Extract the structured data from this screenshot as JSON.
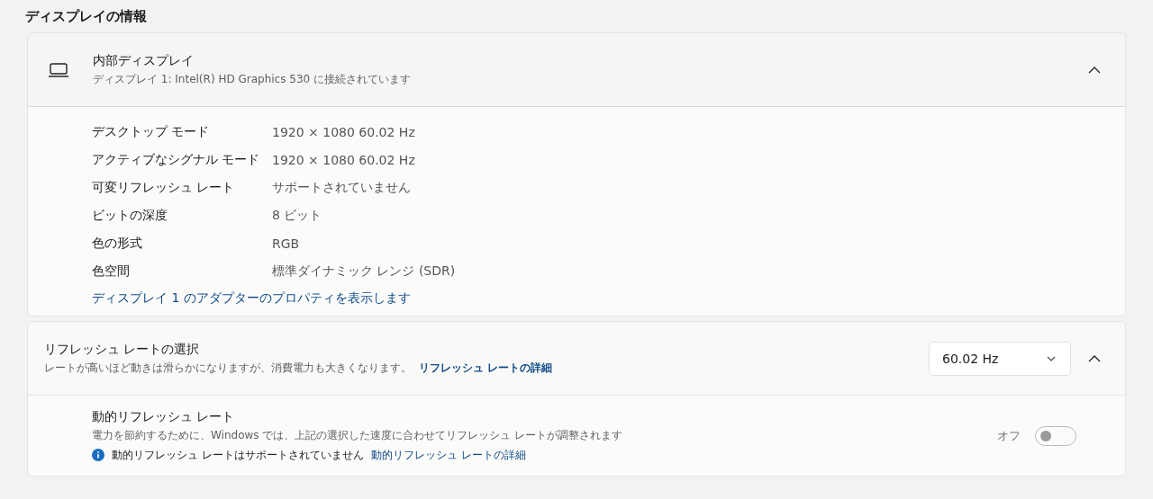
{
  "section_title": "ディスプレイの情報",
  "display_card": {
    "title": "内部ディスプレイ",
    "subtitle": "ディスプレイ 1: Intel(R) HD Graphics 530 に接続されています",
    "expanded": true,
    "properties": [
      {
        "label": "デスクトップ モード",
        "value": "1920 × 1080 60.02 Hz"
      },
      {
        "label": "アクティブなシグナル モード",
        "value": "1920 × 1080 60.02 Hz"
      },
      {
        "label": "可変リフレッシュ レート",
        "value": "サポートされていません"
      },
      {
        "label": "ビットの深度",
        "value": "8 ビット"
      },
      {
        "label": "色の形式",
        "value": "RGB"
      },
      {
        "label": "色空間",
        "value": "標準ダイナミック レンジ (SDR)"
      }
    ],
    "adapter_link": "ディスプレイ 1 のアダプターのプロパティを表示します"
  },
  "refresh_card": {
    "title": "リフレッシュ レートの選択",
    "description": "レートが高いほど動きは滑らかになりますが、消費電力も大きくなります。",
    "link": "リフレッシュ レートの詳細",
    "dropdown_value": "60.02 Hz",
    "expanded": true,
    "dynamic": {
      "title": "動的リフレッシュ レート",
      "description": "電力を節約するために、Windows では、上記の選択した速度に合わせてリフレッシュ レートが調整されます",
      "info": "動的リフレッシュ レートはサポートされていません",
      "info_link": "動的リフレッシュ レートの詳細",
      "toggle_label": "オフ",
      "on": false
    }
  }
}
